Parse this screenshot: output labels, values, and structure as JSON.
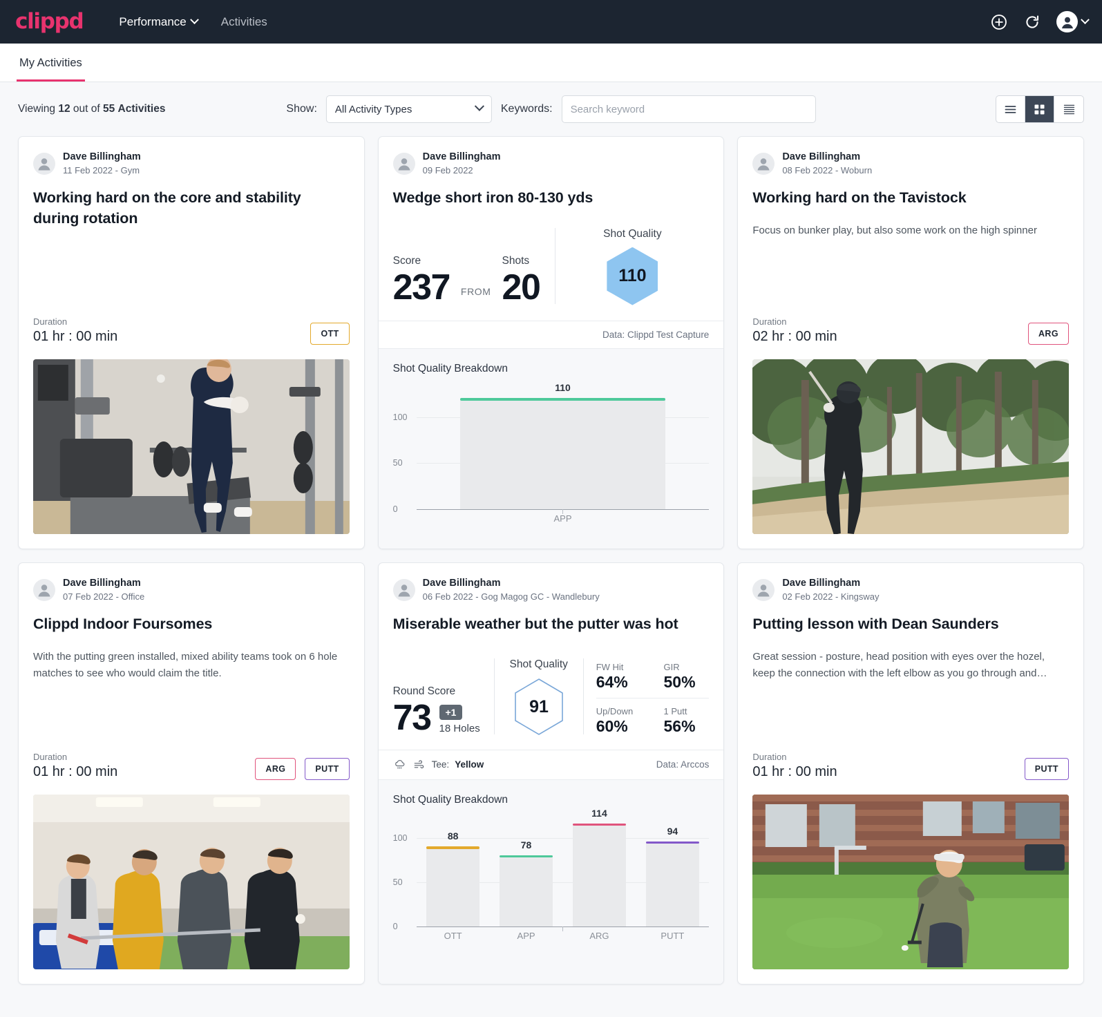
{
  "nav": {
    "logo": "clippd",
    "links": [
      {
        "label": "Performance",
        "has_chevron": true
      },
      {
        "label": "Activities",
        "has_chevron": false
      }
    ],
    "icons": [
      "plus-circle-icon",
      "refresh-icon",
      "avatar-icon",
      "chevron-down-icon"
    ]
  },
  "tabs": [
    {
      "label": "My Activities",
      "active": true
    }
  ],
  "filterbar": {
    "viewing_prefix": "Viewing",
    "viewing_count": "12",
    "viewing_mid": "out of",
    "viewing_total": "55",
    "viewing_suffix": "Activities",
    "show_label": "Show:",
    "activity_type_value": "All Activity Types",
    "keywords_label": "Keywords:",
    "search_placeholder": "Search keyword",
    "search_value": "",
    "view_modes": [
      {
        "name": "list-view",
        "active": false
      },
      {
        "name": "grid-view",
        "active": true
      },
      {
        "name": "compact-view",
        "active": false
      }
    ]
  },
  "colors": {
    "brand": "#e8336e",
    "navbar": "#1c2531",
    "ott": "#e3a92c",
    "app": "#4ec99a",
    "arg": "#e0537c",
    "putt": "#8358c9",
    "hex_fill": "#8ec5f0",
    "hex_outline": "#7aa7d8"
  },
  "cards": [
    {
      "id": "card-core-stability",
      "author": "Dave Billingham",
      "meta": "11 Feb 2022 - Gym",
      "title": "Working hard on the core and stability during rotation",
      "description": "",
      "duration_label": "Duration",
      "duration_value": "01 hr : 00 min",
      "tags": [
        {
          "label": "OTT",
          "cls": "ott"
        }
      ],
      "photo": "gym-workout-photo",
      "has_metrics": false,
      "has_chart": false
    },
    {
      "id": "card-wedge-short-iron",
      "author": "Dave Billingham",
      "meta": "09 Feb 2022",
      "title": "Wedge short iron 80-130 yds",
      "description": "",
      "has_metrics": true,
      "metrics": {
        "score_label": "Score",
        "score_value": "237",
        "from_label": "FROM",
        "shots_label": "Shots",
        "shots_value": "20",
        "shot_quality_label": "Shot Quality",
        "shot_quality_value": "110",
        "hex_style": "fill"
      },
      "source": "Data: Clippd Test Capture",
      "has_chart": true,
      "chart_data": {
        "type": "bar",
        "title": "Shot Quality Breakdown",
        "categories": [
          "APP"
        ],
        "values": [
          110
        ],
        "colors": [
          "#4ec99a"
        ],
        "ylabel": "",
        "xlabel": "",
        "yticks": [
          0,
          50,
          100
        ],
        "ylim": [
          0,
          130
        ],
        "grid": true,
        "legend": "none"
      }
    },
    {
      "id": "card-tavistock",
      "author": "Dave Billingham",
      "meta": "08 Feb 2022 - Woburn",
      "title": "Working hard on the Tavistock",
      "description": "Focus on bunker play, but also some work on the high spinner",
      "duration_label": "Duration",
      "duration_value": "02 hr : 00 min",
      "tags": [
        {
          "label": "ARG",
          "cls": "arg"
        }
      ],
      "photo": "bunker-golf-photo",
      "has_metrics": false,
      "has_chart": false
    },
    {
      "id": "card-indoor-foursomes",
      "author": "Dave Billingham",
      "meta": "07 Feb 2022 - Office",
      "title": "Clippd Indoor Foursomes",
      "description": "With the putting green installed, mixed ability teams took on 6 hole matches to see who would claim the title.",
      "duration_label": "Duration",
      "duration_value": "01 hr : 00 min",
      "tags": [
        {
          "label": "ARG",
          "cls": "arg"
        },
        {
          "label": "PUTT",
          "cls": "putt"
        }
      ],
      "photo": "indoor-team-photo",
      "has_metrics": false,
      "has_chart": false
    },
    {
      "id": "card-miserable-weather",
      "author": "Dave Billingham",
      "meta": "06 Feb 2022 - Gog Magog GC - Wandlebury",
      "title": "Miserable weather but the putter was hot",
      "description": "",
      "has_metrics": true,
      "metrics": {
        "round_score_label": "Round Score",
        "round_score_value": "73",
        "over_par": "+1",
        "holes": "18 Holes",
        "shot_quality_label": "Shot Quality",
        "shot_quality_value": "91",
        "hex_style": "outline",
        "stats": [
          {
            "label": "FW Hit",
            "value": "64%"
          },
          {
            "label": "GIR",
            "value": "50%"
          },
          {
            "label": "Up/Down",
            "value": "60%"
          },
          {
            "label": "1 Putt",
            "value": "56%"
          }
        ]
      },
      "weather_icons": [
        "rain-cloud-icon",
        "wind-icon"
      ],
      "tee_label": "Tee:",
      "tee_value": "Yellow",
      "source": "Data: Arccos",
      "has_chart": true,
      "chart_data": {
        "type": "bar",
        "title": "Shot Quality Breakdown",
        "categories": [
          "OTT",
          "APP",
          "ARG",
          "PUTT"
        ],
        "values": [
          88,
          78,
          114,
          94
        ],
        "colors": [
          "#e3a92c",
          "#4ec99a",
          "#e0537c",
          "#8358c9"
        ],
        "ylabel": "",
        "xlabel": "",
        "yticks": [
          0,
          50,
          100
        ],
        "ylim": [
          0,
          130
        ],
        "grid": true,
        "legend": "none"
      }
    },
    {
      "id": "card-putting-lesson",
      "author": "Dave Billingham",
      "meta": "02 Feb 2022 - Kingsway",
      "title": "Putting lesson with Dean Saunders",
      "description": "Great session - posture, head position with eyes over the hozel, keep the connection with the left elbow as you go through and…",
      "duration_label": "Duration",
      "duration_value": "01 hr : 00 min",
      "tags": [
        {
          "label": "PUTT",
          "cls": "putt"
        }
      ],
      "photo": "putting-green-photo",
      "has_metrics": false,
      "has_chart": false
    }
  ]
}
